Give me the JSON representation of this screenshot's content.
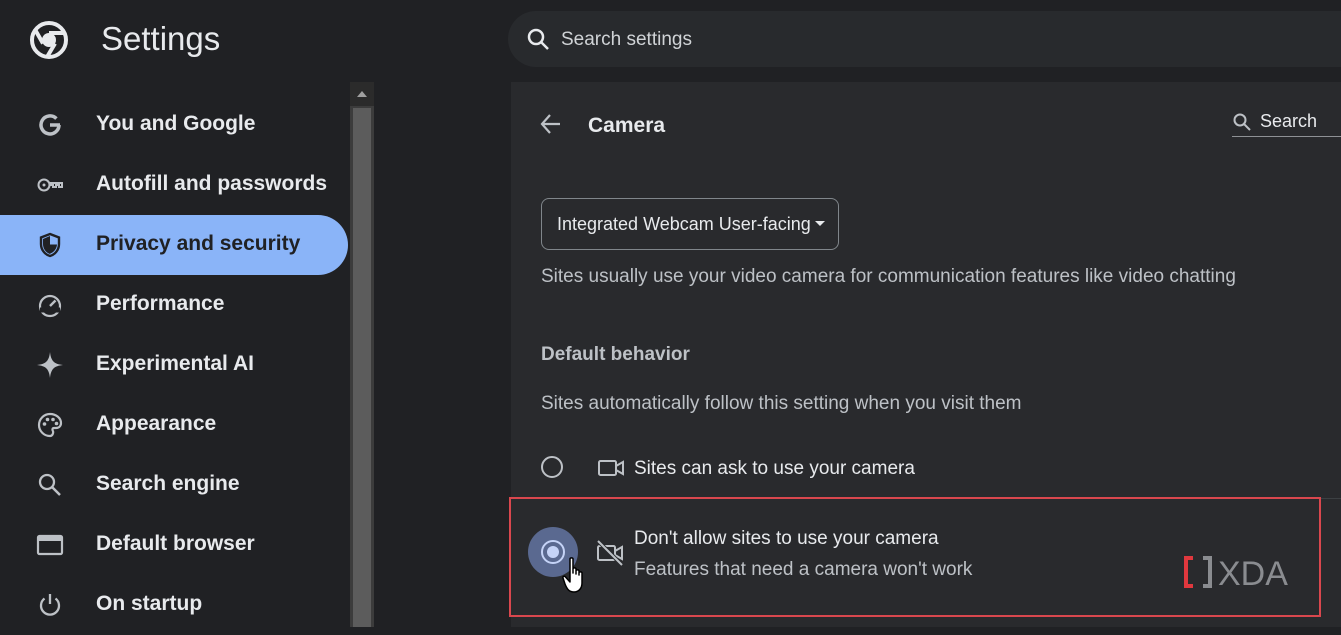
{
  "header": {
    "app_title": "Settings",
    "search_placeholder": "Search settings",
    "logo_icon": "chrome-logo-icon"
  },
  "sidebar": {
    "items": [
      {
        "label": "You and Google",
        "icon": "google-g-icon",
        "active": false
      },
      {
        "label": "Autofill and passwords",
        "icon": "key-icon",
        "active": false
      },
      {
        "label": "Privacy and security",
        "icon": "shield-icon",
        "active": true
      },
      {
        "label": "Performance",
        "icon": "speedometer-icon",
        "active": false
      },
      {
        "label": "Experimental AI",
        "icon": "sparkle-icon",
        "active": false
      },
      {
        "label": "Appearance",
        "icon": "palette-icon",
        "active": false
      },
      {
        "label": "Search engine",
        "icon": "search-icon",
        "active": false
      },
      {
        "label": "Default browser",
        "icon": "browser-window-icon",
        "active": false
      },
      {
        "label": "On startup",
        "icon": "power-icon",
        "active": false
      }
    ]
  },
  "content": {
    "page_title": "Camera",
    "search_label": "Search",
    "camera_select": "Integrated Webcam User-facing",
    "description": "Sites usually use your video camera for communication features like video chatting",
    "default_behavior": {
      "title": "Default behavior",
      "description": "Sites automatically follow this setting when you visit them",
      "options": [
        {
          "label": "Sites can ask to use your camera",
          "sublabel": "",
          "icon": "videocam-icon",
          "selected": false
        },
        {
          "label": "Don't allow sites to use your camera",
          "sublabel": "Features that need a camera won't work",
          "icon": "videocam-off-icon",
          "selected": true
        }
      ]
    }
  },
  "watermark": "XDA",
  "colors": {
    "background": "#202124",
    "content_bg": "#292a2d",
    "active_nav": "#8ab4f8",
    "highlight_box": "#d9474e",
    "watermark_accent": "#e0383e"
  }
}
